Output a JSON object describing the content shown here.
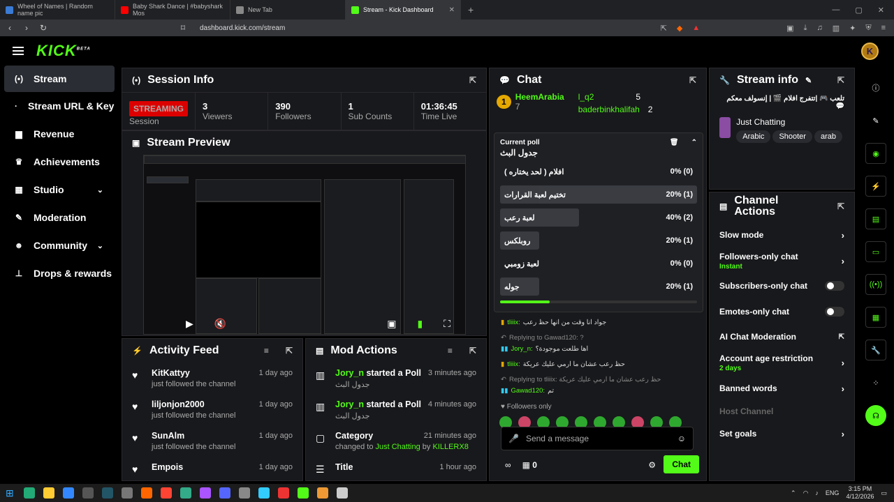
{
  "browser": {
    "tabs": [
      {
        "title": "Wheel of Names | Random name pic",
        "color": "#3a7bd5"
      },
      {
        "title": "Baby Shark Dance | #babyshark Mos",
        "color": "#ff0000"
      },
      {
        "title": "New Tab",
        "color": "#888888"
      },
      {
        "title": "Stream - Kick Dashboard",
        "color": "#53fc18"
      }
    ],
    "url": "dashboard.kick.com/stream"
  },
  "header": {
    "logo": "KICK",
    "logo_beta": "BETA",
    "avatar_letter": "K"
  },
  "sidebar": {
    "items": [
      {
        "label": "Stream",
        "icon": "(•)"
      },
      {
        "label": "Stream URL & Key",
        "icon": "·"
      },
      {
        "label": "Revenue",
        "icon": "▆"
      },
      {
        "label": "Achievements",
        "icon": "♛"
      },
      {
        "label": "Studio",
        "icon": "▦",
        "chevron": "⌄"
      },
      {
        "label": "Moderation",
        "icon": "✎"
      },
      {
        "label": "Community",
        "icon": "☻",
        "chevron": "⌄"
      },
      {
        "label": "Drops & rewards",
        "icon": "⊥"
      }
    ]
  },
  "session": {
    "title": "Session Info",
    "status": "STREAMING",
    "status_sub": "Session",
    "stats": [
      {
        "value": "3",
        "label": "Viewers"
      },
      {
        "value": "390",
        "label": "Followers"
      },
      {
        "value": "1",
        "label": "Sub Counts"
      },
      {
        "value": "01:36:45",
        "label": "Time Live"
      }
    ]
  },
  "preview": {
    "title": "Stream Preview"
  },
  "activity": {
    "title": "Activity Feed",
    "items": [
      {
        "name": "KitKattyy",
        "sub": "just followed the channel",
        "time": "1 day ago"
      },
      {
        "name": "liljonjon2000",
        "sub": "just followed the channel",
        "time": "1 day ago"
      },
      {
        "name": "SunAlm",
        "sub": "just followed the channel",
        "time": "1 day ago"
      },
      {
        "name": "Empois",
        "sub": "",
        "time": "1 day ago"
      }
    ]
  },
  "mod": {
    "title": "Mod Actions",
    "items": [
      {
        "user": "Jory_n",
        "action": "started a Poll",
        "sub": "جدول البث",
        "time": "3 minutes ago"
      },
      {
        "user": "Jory_n",
        "action": "started a Poll",
        "sub": "جدول البث",
        "time": "4 minutes ago"
      },
      {
        "user": "Category",
        "action": "",
        "sub_prefix": "changed to",
        "sub_cat": "Just Chatting",
        "sub_by": "by",
        "sub_user": "KILLERX8",
        "time": "21 minutes ago"
      },
      {
        "user": "Title",
        "action": "",
        "sub": "",
        "time": "1 hour ago"
      }
    ]
  },
  "chat": {
    "title": "Chat",
    "top_gifters": [
      {
        "name": "HeemArabia",
        "count": "7",
        "rank": "1"
      },
      {
        "name": "l_q2",
        "count": "5"
      },
      {
        "name": "baderbinkhalifah",
        "count": "2"
      }
    ],
    "poll": {
      "label": "Current poll",
      "question": "جدول البث",
      "options": [
        {
          "text": "افلام ( لحد يختاره )",
          "pct": "0% (0)",
          "fill": 0,
          "selected": false
        },
        {
          "text": "تختيم لعبة القرارات",
          "pct": "20% (1)",
          "fill": 20,
          "selected": true
        },
        {
          "text": "لعبة رعب",
          "pct": "40% (2)",
          "fill": 40,
          "selected": false
        },
        {
          "text": "روبلكس",
          "pct": "20% (1)",
          "fill": 20,
          "selected": false
        },
        {
          "text": "لعبة زومبي",
          "pct": "0% (0)",
          "fill": 0,
          "selected": false
        },
        {
          "text": "جوله",
          "pct": "20% (1)",
          "fill": 20,
          "selected": false
        }
      ],
      "time_progress": 25
    },
    "messages": [
      {
        "type": "msg",
        "user": "tliiix:",
        "text": "جواد انا وقت من انها حظ رعب"
      },
      {
        "type": "reply",
        "text": "Replying to Gawad120: ?"
      },
      {
        "type": "msg",
        "user": "Jory_n:",
        "text": "اها طلعت موجودة؟"
      },
      {
        "type": "msg",
        "user": "tliiix:",
        "text": "حظ رعب عشان ما ارمي عليك عريكة"
      },
      {
        "type": "reply",
        "text": "Replying to tliiix: حظ رعب عشان ما ارمي عليك عريكة"
      },
      {
        "type": "msg",
        "user": "Gawad120:",
        "text": "تم"
      }
    ],
    "followers_only": "Followers only",
    "placeholder": "Send a message",
    "points": "0",
    "send_label": "Chat"
  },
  "stream_info": {
    "title": "Stream info",
    "stream_title": "تلعب 🎮 |تتفرج افلام 🎬 | إنسولف معكم 💬",
    "category": "Just Chatting",
    "tags": [
      "Arabic",
      "Shooter",
      "arab"
    ]
  },
  "channel_actions": {
    "title": "Channel Actions",
    "rows": [
      {
        "label": "Slow mode",
        "kind": "arrow"
      },
      {
        "label": "Followers-only chat",
        "sub": "Instant",
        "kind": "arrow"
      },
      {
        "label": "Subscribers-only chat",
        "kind": "toggle"
      },
      {
        "label": "Emotes-only chat",
        "kind": "toggle"
      },
      {
        "label": "AI Chat Moderation",
        "kind": "external"
      },
      {
        "label": "Account age restriction",
        "sub": "2 days",
        "kind": "arrow"
      },
      {
        "label": "Banned words",
        "kind": "arrow"
      },
      {
        "label": "Host Channel",
        "kind": "disabled"
      },
      {
        "label": "Set goals",
        "kind": "arrow"
      }
    ]
  },
  "taskbar": {
    "time": "3:15 PM",
    "date": "4/12/2026",
    "lang": "ENG"
  }
}
